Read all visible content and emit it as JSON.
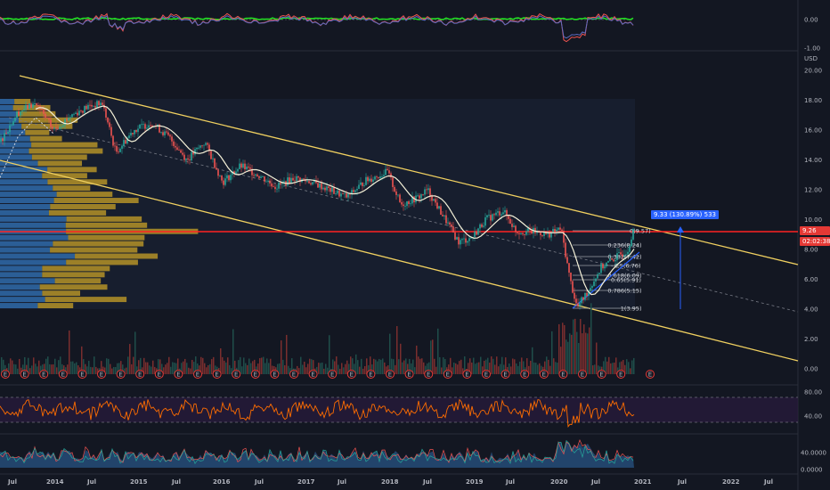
{
  "colors": {
    "background": "#131722",
    "channel": "#f0d060",
    "volume_profile_up": "#2f6aa8",
    "volume_profile_down": "#c9a227",
    "hline": "#ff2222",
    "price_badge": "#e53935",
    "ma": "#f5f1d8",
    "fib": "#9aa0a6",
    "measure": "#2962ff"
  },
  "osc_axis": {
    "labels": [
      "0.00",
      "-1.00"
    ]
  },
  "price_axis": {
    "currency": "USD",
    "labels": [
      "20.00",
      "18.00",
      "16.00",
      "14.00",
      "12.00",
      "10.00",
      "8.00",
      "6.00",
      "4.00",
      "2.00",
      "0.00"
    ]
  },
  "price_badge": {
    "price": "9.26",
    "countdown": "02:02:38"
  },
  "measure_label": "9.33 (130.89%) 533",
  "fib_levels": [
    {
      "label": "0(9.57)"
    },
    {
      "label": "0.236(8.24)"
    },
    {
      "label": "0.382(7.42)"
    },
    {
      "label": "0.5(6.76)"
    },
    {
      "label": "0.618(6.09)"
    },
    {
      "label": "0.65(5.91)"
    },
    {
      "label": "0.786(5.15)"
    },
    {
      "label": "1(3.95)"
    }
  ],
  "rsi_axis": {
    "labels": [
      "80.00",
      "40.00"
    ]
  },
  "bottom_axis": {
    "labels": [
      "40.0000",
      "0.0000"
    ]
  },
  "earnings_marker": "E",
  "time_axis": {
    "labels": [
      "Jul",
      "2014",
      "Jul",
      "2015",
      "Jul",
      "2016",
      "Jul",
      "2017",
      "Jul",
      "2018",
      "Jul",
      "2019",
      "Jul",
      "2020",
      "Jul",
      "2021",
      "Jul",
      "2022",
      "Jul"
    ]
  }
}
